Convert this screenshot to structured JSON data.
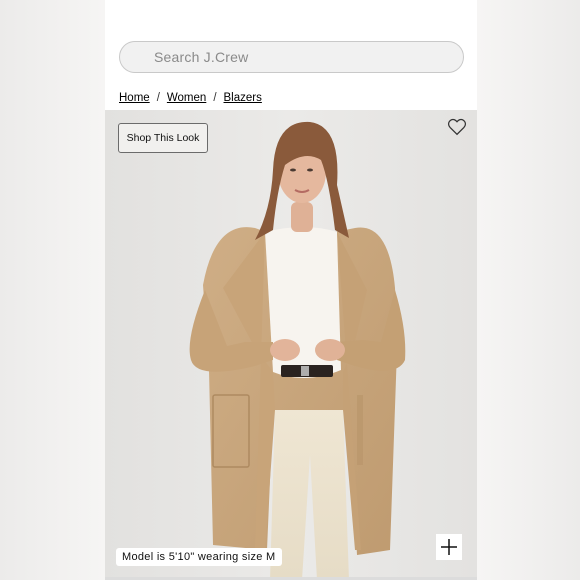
{
  "search": {
    "placeholder": "Search J.Crew"
  },
  "breadcrumb": {
    "items": [
      "Home",
      "Women",
      "Blazers"
    ],
    "separator": "/"
  },
  "hero": {
    "shop_look_label": "Shop This Look",
    "model_note": "Model is 5'10\" wearing size M",
    "icons": {
      "favorite": "heart-icon",
      "expand": "plus-icon"
    }
  },
  "colors": {
    "background": "#ffffff",
    "hero_background": "#e7e6e4",
    "cardigan": "#c9a67c",
    "text": "#111111"
  }
}
